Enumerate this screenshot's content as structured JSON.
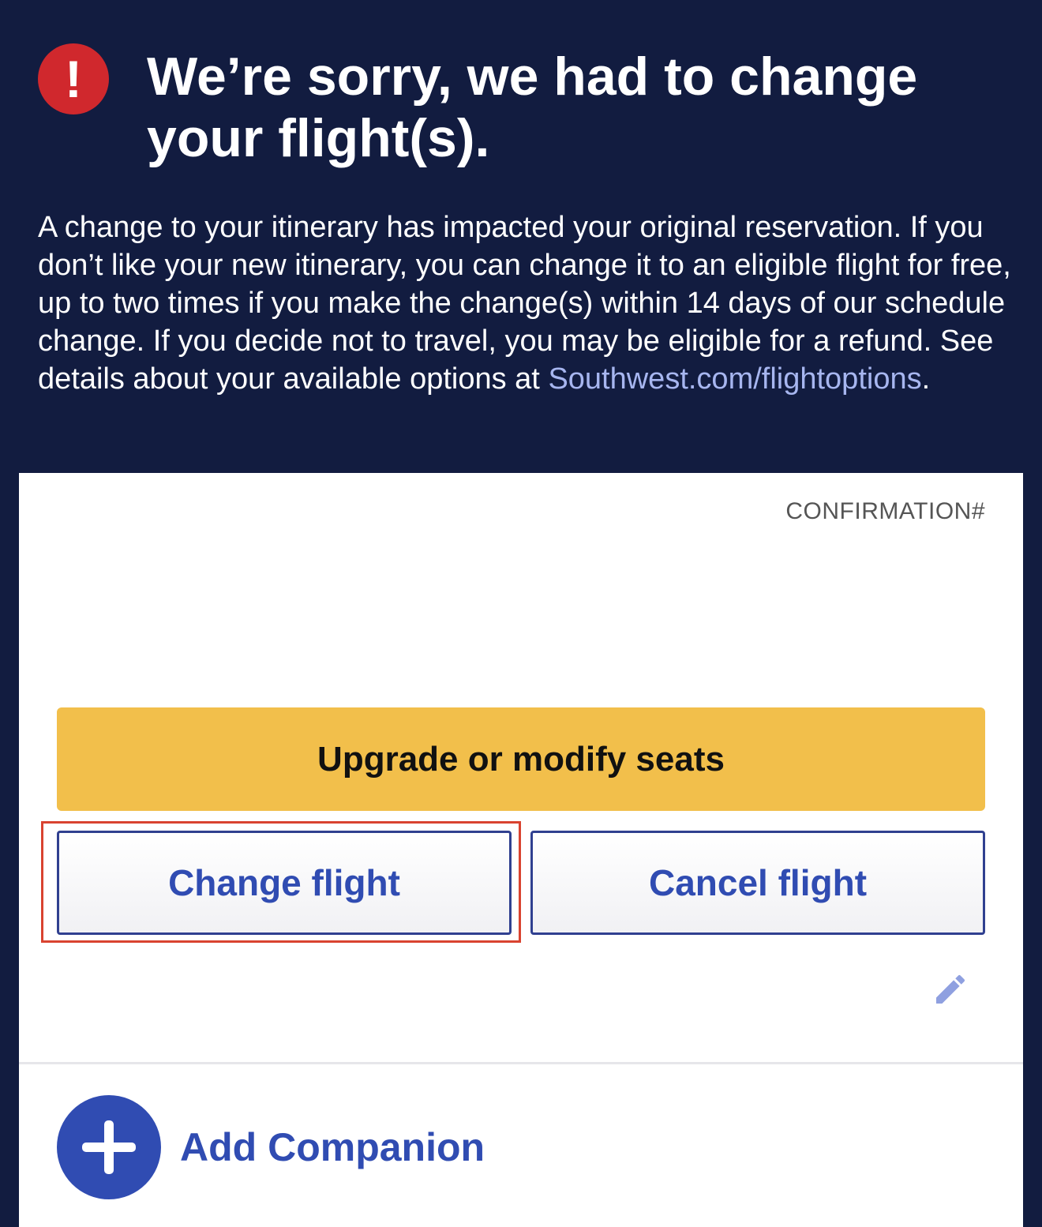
{
  "alert": {
    "icon": "exclamation-icon",
    "icon_glyph": "!",
    "title": "We’re sorry, we had to change your flight(s).",
    "message_text": "A change to your itinerary has impacted your original reservation. If you don’t like your new itinerary, you can change it to an eligible flight for free, up to two times if you make the change(s) within 14 days of our schedule change. If you decide not to travel, you may be eligible for a refund. See details about your available options at ",
    "message_link": "Southwest.com/flightoptions",
    "message_end": "."
  },
  "reservation": {
    "confirmation_label": "CONFIRMATION#",
    "upgrade_button": "Upgrade or modify seats",
    "change_button": "Change flight",
    "cancel_button": "Cancel flight",
    "edit_icon": "pencil-icon",
    "add_companion_icon": "plus-icon",
    "add_companion_label": "Add Companion"
  },
  "colors": {
    "header_bg": "#121c40",
    "alert_red": "#d0282d",
    "link": "#a7b6f0",
    "upgrade_yellow": "#f2bf4b",
    "primary_blue": "#304cb2",
    "highlight_red": "#d94330"
  }
}
